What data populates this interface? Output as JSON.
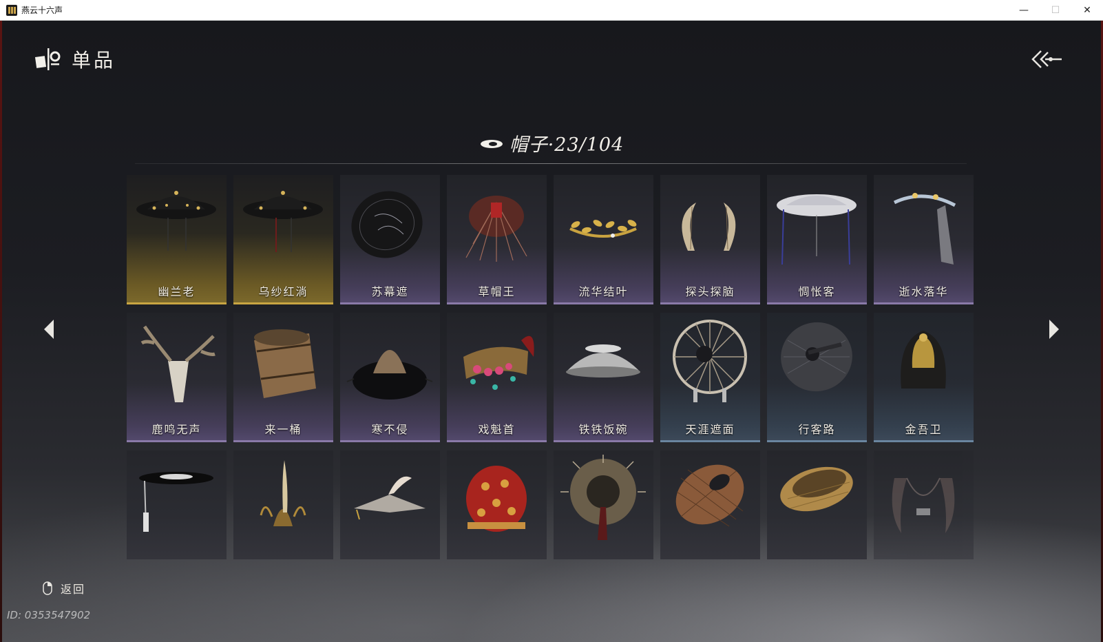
{
  "window": {
    "title": "燕云十六声",
    "minimize_label": "—",
    "maximize_label": "☐",
    "close_label": "✕"
  },
  "header": {
    "title": "单品",
    "icon": "wardrobe-icon",
    "back_icon": "back-arrow-icon"
  },
  "category": {
    "icon": "hat-icon",
    "label": "帽子·23/104"
  },
  "colors": {
    "gold": "#c9a542",
    "purple": "#8a7aa8",
    "blue": "#6a86a0"
  },
  "items": [
    {
      "name": "幽兰老",
      "rarity": "gold",
      "art": "black-bamboo-hat"
    },
    {
      "name": "乌纱红淌",
      "rarity": "gold",
      "art": "black-bamboo-hat-red"
    },
    {
      "name": "苏幕遮",
      "rarity": "purple",
      "art": "dark-round-hat"
    },
    {
      "name": "草帽王",
      "rarity": "purple",
      "art": "straw-fringe-hat"
    },
    {
      "name": "流华结叶",
      "rarity": "purple",
      "art": "golden-leaf-crown"
    },
    {
      "name": "探头探脑",
      "rarity": "purple",
      "art": "feather-antennae"
    },
    {
      "name": "惆怅客",
      "rarity": "purple",
      "art": "white-veil-hat"
    },
    {
      "name": "逝水落华",
      "rarity": "purple",
      "art": "silver-headpiece"
    },
    {
      "name": "鹿鸣无声",
      "rarity": "purple",
      "art": "deer-skull"
    },
    {
      "name": "来一桶",
      "rarity": "purple",
      "art": "wooden-bucket"
    },
    {
      "name": "寒不侵",
      "rarity": "purple",
      "art": "fur-hat"
    },
    {
      "name": "戏魁首",
      "rarity": "purple",
      "art": "opera-crown"
    },
    {
      "name": "铁铁饭碗",
      "rarity": "purple",
      "art": "iron-bowl"
    },
    {
      "name": "天涯遮面",
      "rarity": "blue",
      "art": "wicker-screen"
    },
    {
      "name": "行客路",
      "rarity": "blue",
      "art": "grey-wicker-hat"
    },
    {
      "name": "金吾卫",
      "rarity": "blue",
      "art": "gold-helmet"
    },
    {
      "name": "",
      "rarity": "none",
      "art": "black-disc-hat"
    },
    {
      "name": "",
      "rarity": "none",
      "art": "golden-horned-crown"
    },
    {
      "name": "",
      "rarity": "none",
      "art": "winged-flat-hat"
    },
    {
      "name": "",
      "rarity": "none",
      "art": "red-round-cap"
    },
    {
      "name": "",
      "rarity": "none",
      "art": "spiky-straw-hat"
    },
    {
      "name": "",
      "rarity": "none",
      "art": "woven-basket-hat"
    },
    {
      "name": "",
      "rarity": "none",
      "art": "woven-bowl-hat"
    },
    {
      "name": "",
      "rarity": "none",
      "art": "fur-tail-headpiece"
    }
  ],
  "nav": {
    "prev_icon": "arrow-left-icon",
    "next_icon": "arrow-right-icon"
  },
  "footer": {
    "mouse_icon": "mouse-icon",
    "return_label": "返回",
    "uid": "ID: 0353547902"
  }
}
